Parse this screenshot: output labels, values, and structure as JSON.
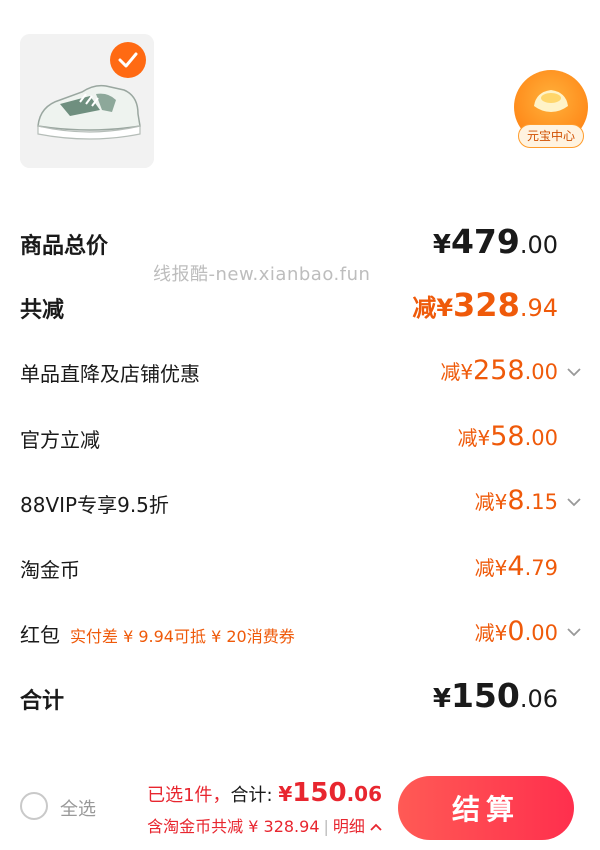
{
  "product": {
    "selected": true
  },
  "yuanbao": {
    "label": "元宝中心"
  },
  "watermark": "线报酷-new.xianbao.fun",
  "rows": {
    "total_price": {
      "label": "商品总价",
      "cur": "¥",
      "int": "479",
      "dec": ".00"
    },
    "total_reduce": {
      "label": "共减",
      "prefix": "减",
      "cur": "¥",
      "int": "328",
      "dec": ".94"
    },
    "item_discount": {
      "label": "单品直降及店铺优惠",
      "prefix": "减",
      "cur": "¥",
      "int": "258",
      "dec": ".00"
    },
    "official": {
      "label": "官方立减",
      "prefix": "减",
      "cur": "¥",
      "int": "58",
      "dec": ".00"
    },
    "vip": {
      "label": "88VIP专享9.5折",
      "prefix": "减",
      "cur": "¥",
      "int": "8",
      "dec": ".15"
    },
    "taojinbi": {
      "label": "淘金币",
      "prefix": "减",
      "cur": "¥",
      "int": "4",
      "dec": ".79"
    },
    "hongbao": {
      "label": "红包",
      "note": "实付差 ¥ 9.94可抵 ¥ 20消费券",
      "prefix": "减",
      "cur": "¥",
      "int": "0",
      "dec": ".00"
    },
    "grand_total": {
      "label": "合计",
      "cur": "¥",
      "int": "150",
      "dec": ".06"
    }
  },
  "bottom_bar": {
    "select_all": "全选",
    "selected_text": "已选1件，",
    "total_label": "合计:",
    "total_cur": "¥",
    "total_int": "150",
    "total_dec": ".06",
    "line2_text": "含淘金币共减 ¥ 328.94",
    "separator": "|",
    "detail_label": "明细",
    "checkout_label": "结算"
  },
  "colors": {
    "accent": "#ef5a0a",
    "checkout": "#ff2f4d",
    "price_red": "#e8262f"
  }
}
